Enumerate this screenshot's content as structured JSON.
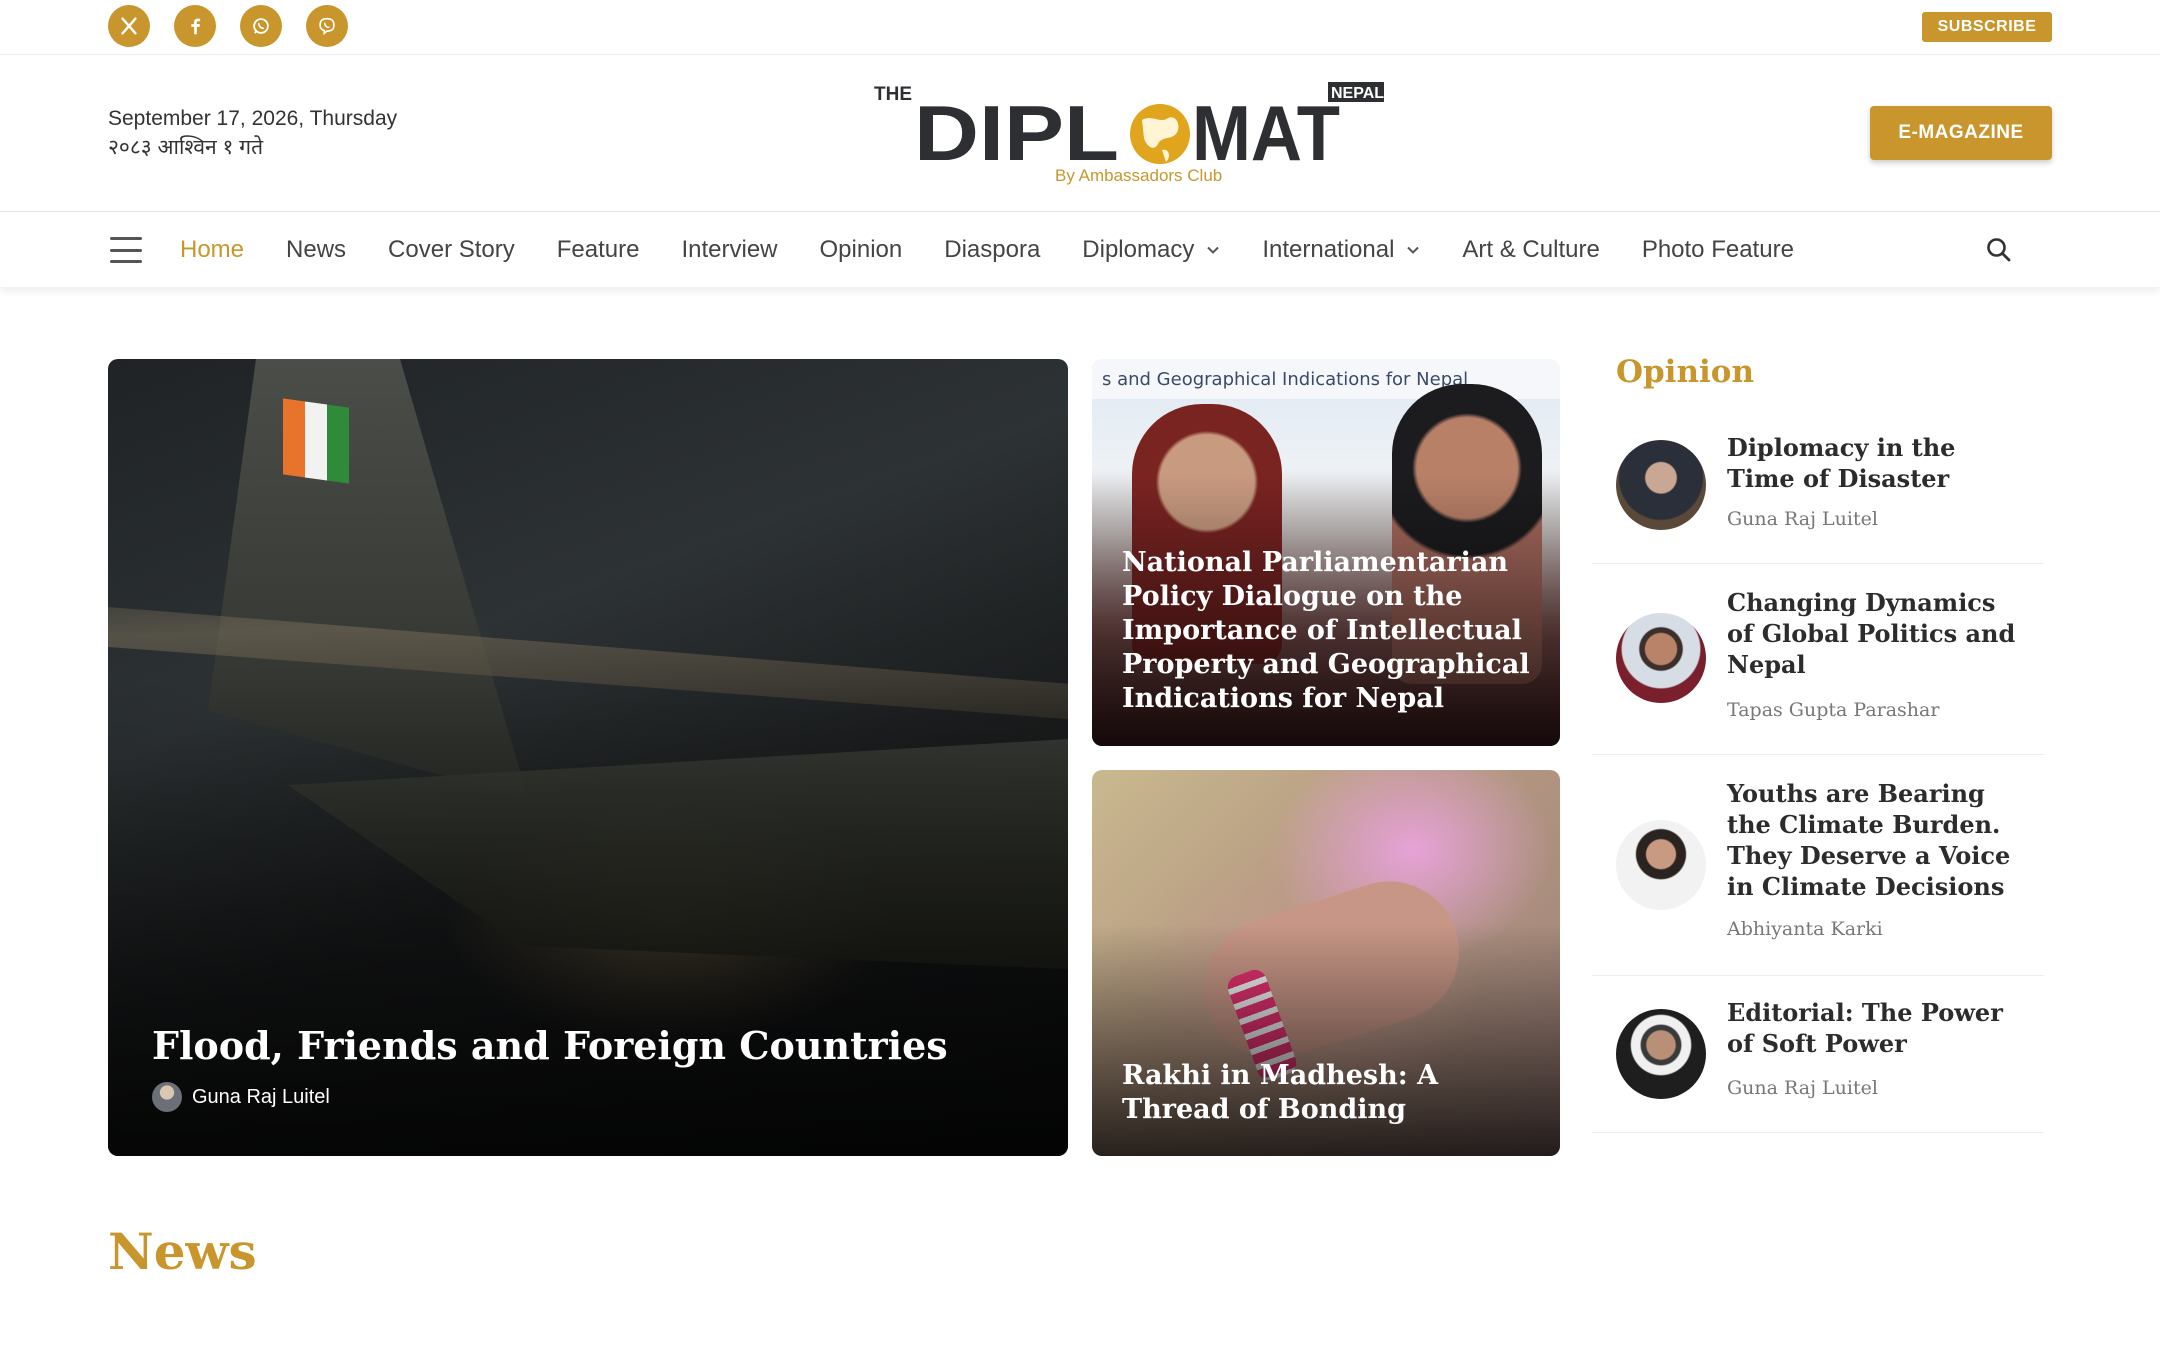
{
  "social": {
    "icons": [
      "x-icon",
      "facebook-icon",
      "whatsapp-icon",
      "viber-icon"
    ]
  },
  "subscribe_label": "SUBSCRIBE",
  "header": {
    "date_en": "September 17, 2026, Thursday",
    "date_np": "२०८३ आश्विन १ गते",
    "logo": {
      "the": "THE",
      "word_left": "DIPL",
      "word_right": "MAT",
      "country": "NEPAL",
      "byline": "By Ambassadors Club"
    },
    "emagazine_label": "E-MAGAZINE"
  },
  "nav": {
    "items": [
      {
        "label": "Home",
        "active": true
      },
      {
        "label": "News"
      },
      {
        "label": "Cover Story"
      },
      {
        "label": "Feature"
      },
      {
        "label": "Interview"
      },
      {
        "label": "Opinion"
      },
      {
        "label": "Diaspora"
      },
      {
        "label": "Diplomacy",
        "dropdown": true
      },
      {
        "label": "International",
        "dropdown": true
      },
      {
        "label": "Art & Culture"
      },
      {
        "label": "Photo Feature"
      }
    ]
  },
  "hero": {
    "main": {
      "title": "Flood, Friends and Foreign Countries",
      "author": "Guna Raj Luitel"
    },
    "side1": {
      "banner": "s and Geographical Indications for Nepal",
      "title": "National Parliamentarian Policy Dialogue on the Importance of Intellectual Property and Geographical Indications for Nepal"
    },
    "side2": {
      "title": "Rakhi in Madhesh: A Thread of Bonding"
    }
  },
  "opinion": {
    "heading": "Opinion",
    "items": [
      {
        "title": "Diplomacy in the Time of Disaster",
        "author": "Guna Raj Luitel"
      },
      {
        "title": "Changing Dynamics of Global Politics and Nepal",
        "author": "Tapas Gupta Parashar"
      },
      {
        "title": "Youths are Bearing the Climate Burden. They Deserve a Voice in Climate Decisions",
        "author": "Abhiyanta Karki"
      },
      {
        "title": "Editorial: The Power of Soft Power",
        "author": "Guna Raj Luitel"
      }
    ]
  },
  "news_heading": "News",
  "colors": {
    "accent": "#c8962c",
    "text": "#2b2b2b"
  }
}
